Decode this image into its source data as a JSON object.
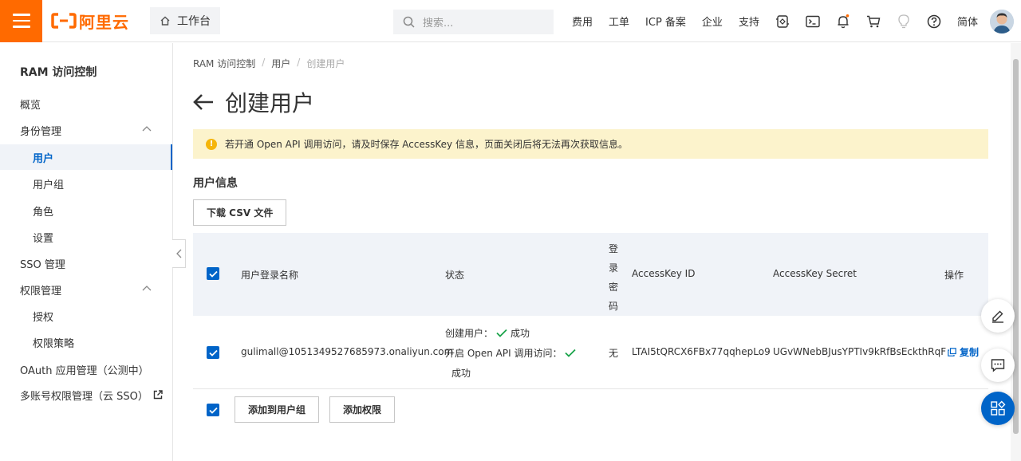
{
  "brand": {
    "name": "阿里云",
    "accent": "#ff6a00"
  },
  "header": {
    "workbench_label": "工作台",
    "search_placeholder": "搜索...",
    "links": [
      "费用",
      "工单",
      "ICP 备案",
      "企业",
      "支持"
    ],
    "lang": "简体"
  },
  "sidebar": {
    "title": "RAM 访问控制",
    "items": [
      {
        "label": "概览"
      },
      {
        "label": "身份管理"
      },
      {
        "label": "用户"
      },
      {
        "label": "用户组"
      },
      {
        "label": "角色"
      },
      {
        "label": "设置"
      },
      {
        "label": "SSO 管理"
      },
      {
        "label": "权限管理"
      },
      {
        "label": "授权"
      },
      {
        "label": "权限策略"
      },
      {
        "label": "OAuth 应用管理（公测中）"
      },
      {
        "label": "多账号权限管理（云 SSO）"
      }
    ]
  },
  "breadcrumb": [
    "RAM 访问控制",
    "/",
    "用户",
    "/",
    "创建用户"
  ],
  "page": {
    "title": "创建用户",
    "alert": "若开通 Open API 调用访问，请及时保存 AccessKey 信息，页面关闭后将无法再次获取信息。",
    "section_title": "用户信息",
    "download_btn": "下载 CSV 文件"
  },
  "table": {
    "headers": {
      "login_name": "用户登录名称",
      "status": "状态",
      "password": [
        "登",
        "录",
        "密",
        "码"
      ],
      "ak_id": "AccessKey ID",
      "ak_secret": "AccessKey Secret",
      "action": "操作"
    },
    "row": {
      "login_name": "gulimall@1051349527685973.onaliyun.com",
      "status_create": "创建用户：",
      "status_create_result": "成功",
      "status_api": "开启 Open API 调用访问：",
      "status_api_result": "成功",
      "password": "无",
      "ak_id": "LTAI5tQRCX6FBx77qqhepLo9",
      "ak_secret": "UGvWNebBJusYPTIv9kRfBsEckthRqF",
      "action": "复制"
    }
  },
  "footer_actions": {
    "add_group": "添加到用户组",
    "add_permission": "添加权限"
  }
}
